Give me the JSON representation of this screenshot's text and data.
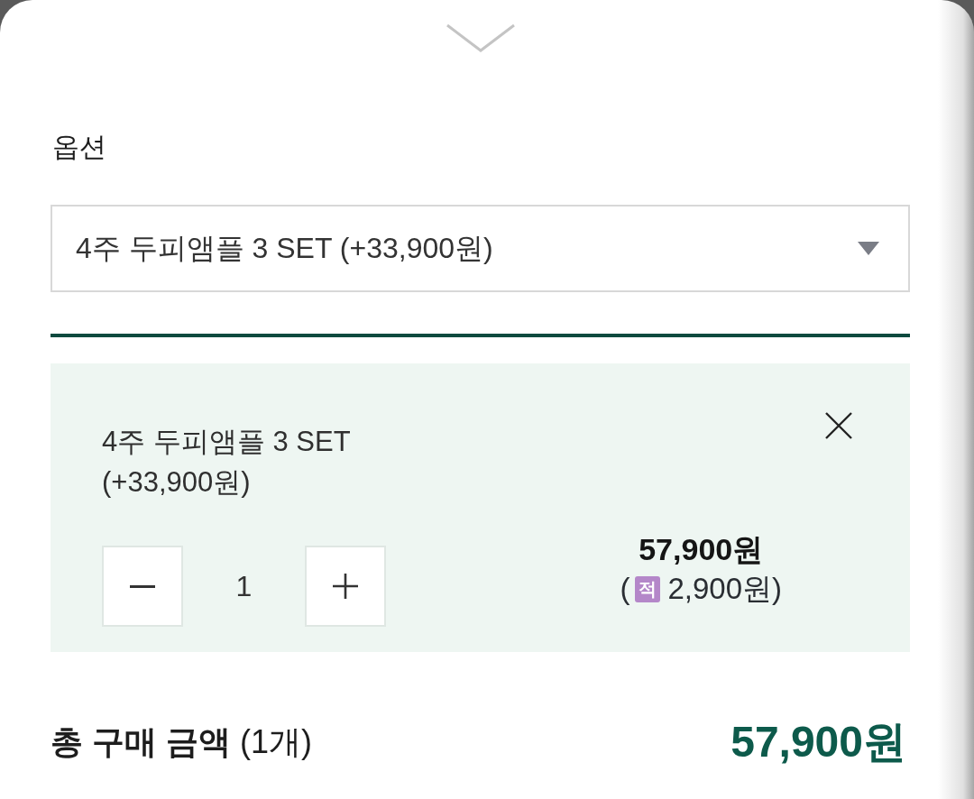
{
  "option": {
    "label": "옵션",
    "select": {
      "value": "4주 두피앰플 3 SET (+33,900원)"
    }
  },
  "selected_items": [
    {
      "name": "4주 두피앰플 3 SET (+33,900원)",
      "quantity": "1",
      "price": "57,900원",
      "points": {
        "badge": "적",
        "open": "(",
        "amount": "2,900원)"
      }
    }
  ],
  "total": {
    "label": "**총 구매 금액** (1개)",
    "amount": "57,900원"
  }
}
